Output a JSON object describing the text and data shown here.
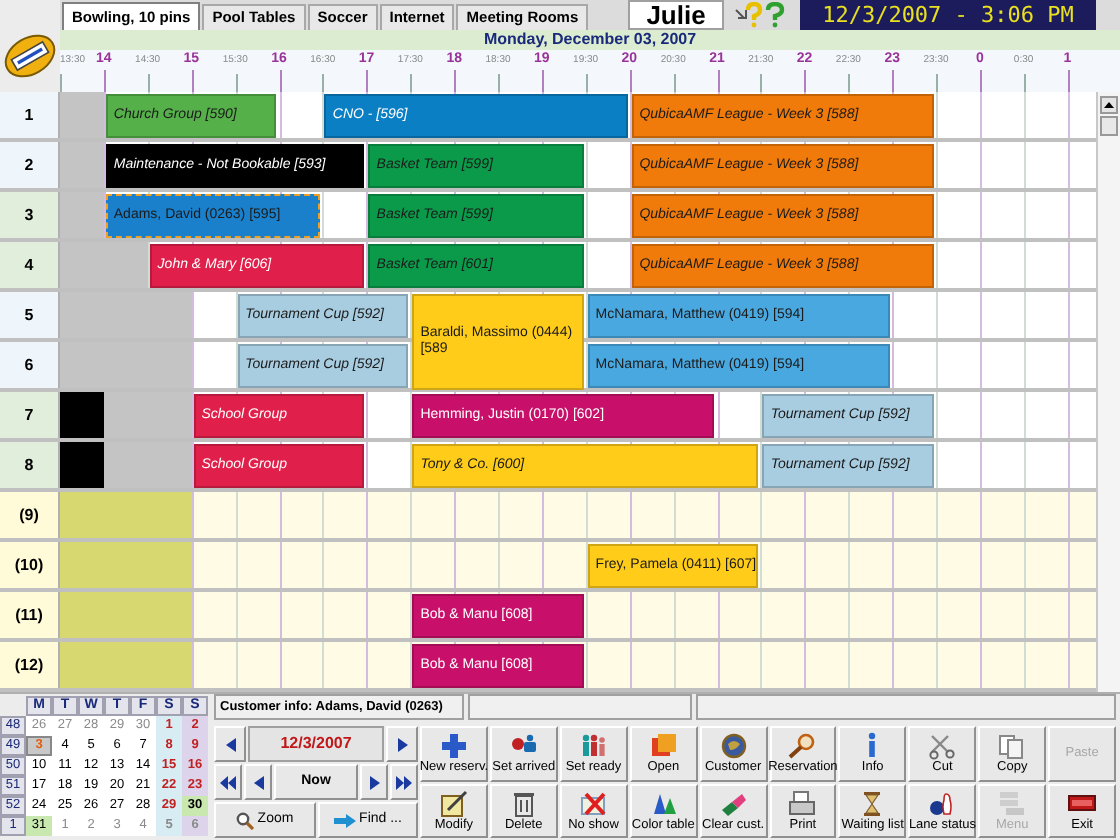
{
  "tabs": [
    {
      "label": "Bowling, 10 pins",
      "selected": true
    },
    {
      "label": "Pool Tables",
      "selected": false
    },
    {
      "label": "Soccer",
      "selected": false
    },
    {
      "label": "Internet",
      "selected": false
    },
    {
      "label": "Meeting Rooms",
      "selected": false
    }
  ],
  "user": "Julie",
  "clock": "12/3/2007 - 3:06 PM",
  "date_heading": "Monday, December 03, 2007",
  "time_scale": [
    {
      "label": "13:30",
      "kind": "minor"
    },
    {
      "label": "14",
      "kind": "major"
    },
    {
      "label": "14:30",
      "kind": "minor"
    },
    {
      "label": "15",
      "kind": "major"
    },
    {
      "label": "15:30",
      "kind": "minor"
    },
    {
      "label": "16",
      "kind": "major"
    },
    {
      "label": "16:30",
      "kind": "minor"
    },
    {
      "label": "17",
      "kind": "major"
    },
    {
      "label": "17:30",
      "kind": "minor"
    },
    {
      "label": "18",
      "kind": "major"
    },
    {
      "label": "18:30",
      "kind": "minor"
    },
    {
      "label": "19",
      "kind": "major"
    },
    {
      "label": "19:30",
      "kind": "minor"
    },
    {
      "label": "20",
      "kind": "major"
    },
    {
      "label": "20:30",
      "kind": "minor"
    },
    {
      "label": "21",
      "kind": "major"
    },
    {
      "label": "21:30",
      "kind": "minor"
    },
    {
      "label": "22",
      "kind": "major"
    },
    {
      "label": "22:30",
      "kind": "minor"
    },
    {
      "label": "23",
      "kind": "major"
    },
    {
      "label": "23:30",
      "kind": "minor"
    },
    {
      "label": "0",
      "kind": "major"
    },
    {
      "label": "0:30",
      "kind": "minor"
    },
    {
      "label": "1",
      "kind": "major"
    }
  ],
  "lanes": [
    {
      "label": "1",
      "active": true,
      "cells": [
        {
          "kind": "unavailable"
        },
        {
          "kind": "group",
          "label": "Church Group [590]",
          "color": "#56b04a",
          "selected": false,
          "spans_next_lane": false
        },
        {
          "kind": "cont"
        },
        {
          "kind": "cont"
        },
        {
          "kind": "cont"
        },
        {
          "kind": "free"
        },
        {
          "kind": "group",
          "label": "CNO - [596]",
          "color": "#0a7fc4",
          "selected": false,
          "spans_next_lane": false
        },
        {
          "kind": "cont"
        },
        {
          "kind": "cont"
        },
        {
          "kind": "cont"
        },
        {
          "kind": "cont"
        },
        {
          "kind": "cont"
        },
        {
          "kind": "cont"
        },
        {
          "kind": "group",
          "label": "QubicaAMF League - Week 3 [588]",
          "color": "#f07a0a",
          "selected": false,
          "spans_next_lane": false
        },
        {
          "kind": "cont"
        },
        {
          "kind": "cont"
        },
        {
          "kind": "cont"
        },
        {
          "kind": "cont"
        },
        {
          "kind": "cont"
        },
        {
          "kind": "cont"
        }
      ]
    },
    {
      "label": "2",
      "active": true,
      "cells": [
        {
          "kind": "unavailable"
        },
        {
          "kind": "group",
          "label": "Maintenance - Not Bookable [593]",
          "color": "#000000",
          "selected": false,
          "spans_next_lane": false
        },
        {
          "kind": "cont"
        },
        {
          "kind": "cont"
        },
        {
          "kind": "cont"
        },
        {
          "kind": "cont"
        },
        {
          "kind": "cont"
        },
        {
          "kind": "group",
          "label": "Basket Team [599]",
          "color": "#0a9a4a",
          "selected": false,
          "spans_next_lane": false
        },
        {
          "kind": "cont"
        },
        {
          "kind": "cont"
        },
        {
          "kind": "cont"
        },
        {
          "kind": "cont"
        },
        {
          "kind": "free"
        },
        {
          "kind": "group",
          "label": "QubicaAMF League - Week 3 [588]",
          "color": "#f07a0a",
          "selected": false,
          "spans_next_lane": false
        },
        {
          "kind": "cont"
        },
        {
          "kind": "cont"
        },
        {
          "kind": "cont"
        },
        {
          "kind": "cont"
        },
        {
          "kind": "cont"
        },
        {
          "kind": "cont"
        }
      ]
    },
    {
      "label": "3",
      "active": true,
      "cells": [
        {
          "kind": "unavailable"
        },
        {
          "kind": "customer",
          "label": "Adams, David (0263) [595]",
          "color": "#1a80cc",
          "selected": true,
          "spans_next_lane": false
        },
        {
          "kind": "cont"
        },
        {
          "kind": "cont"
        },
        {
          "kind": "cont"
        },
        {
          "kind": "cont"
        },
        {
          "kind": "free"
        },
        {
          "kind": "group",
          "label": "Basket Team [599]",
          "color": "#0a9a4a",
          "selected": false,
          "spans_next_lane": false
        },
        {
          "kind": "cont"
        },
        {
          "kind": "cont"
        },
        {
          "kind": "cont"
        },
        {
          "kind": "cont"
        },
        {
          "kind": "free"
        },
        {
          "kind": "group",
          "label": "QubicaAMF League - Week 3 [588]",
          "color": "#f07a0a",
          "selected": false,
          "spans_next_lane": false
        },
        {
          "kind": "cont"
        },
        {
          "kind": "cont"
        },
        {
          "kind": "cont"
        },
        {
          "kind": "cont"
        },
        {
          "kind": "cont"
        },
        {
          "kind": "cont"
        }
      ]
    },
    {
      "label": "4",
      "active": true,
      "cells": [
        {
          "kind": "unavailable"
        },
        {
          "kind": "unavailable"
        },
        {
          "kind": "group",
          "label": "John & Mary [606]",
          "color": "#e0204a",
          "selected": false,
          "spans_next_lane": false
        },
        {
          "kind": "cont"
        },
        {
          "kind": "cont"
        },
        {
          "kind": "cont"
        },
        {
          "kind": "cont"
        },
        {
          "kind": "group",
          "label": "Basket Team [601]",
          "color": "#0a9a4a",
          "selected": false,
          "spans_next_lane": false
        },
        {
          "kind": "cont"
        },
        {
          "kind": "cont"
        },
        {
          "kind": "cont"
        },
        {
          "kind": "cont"
        },
        {
          "kind": "free"
        },
        {
          "kind": "group",
          "label": "QubicaAMF League - Week 3 [588]",
          "color": "#f07a0a",
          "selected": false,
          "spans_next_lane": false
        },
        {
          "kind": "cont"
        },
        {
          "kind": "cont"
        },
        {
          "kind": "cont"
        },
        {
          "kind": "cont"
        },
        {
          "kind": "cont"
        },
        {
          "kind": "cont"
        }
      ]
    },
    {
      "label": "5",
      "active": true,
      "cells": [
        {
          "kind": "unavailable"
        },
        {
          "kind": "unavailable"
        },
        {
          "kind": "unavailable"
        },
        {
          "kind": "free"
        },
        {
          "kind": "group",
          "label": "Tournament Cup [592]",
          "color": "#a8cce0",
          "selected": false,
          "spans_next_lane": false
        },
        {
          "kind": "cont"
        },
        {
          "kind": "cont"
        },
        {
          "kind": "cont"
        },
        {
          "kind": "customer",
          "label": "Baraldi, Massimo (0444) [589",
          "color": "#ffcc1a",
          "selected": false,
          "spans_next_lane": true
        },
        {
          "kind": "cont"
        },
        {
          "kind": "cont"
        },
        {
          "kind": "cont"
        },
        {
          "kind": "customer",
          "label": "McNamara, Matthew (0419) [594]",
          "color": "#4aa8e0",
          "selected": false,
          "spans_next_lane": false
        },
        {
          "kind": "cont"
        },
        {
          "kind": "cont"
        },
        {
          "kind": "cont"
        },
        {
          "kind": "cont"
        },
        {
          "kind": "cont"
        },
        {
          "kind": "cont"
        }
      ]
    },
    {
      "label": "6",
      "active": true,
      "cells": [
        {
          "kind": "unavailable"
        },
        {
          "kind": "unavailable"
        },
        {
          "kind": "unavailable"
        },
        {
          "kind": "free"
        },
        {
          "kind": "group",
          "label": "Tournament Cup [592]",
          "color": "#a8cce0",
          "selected": false,
          "spans_next_lane": false
        },
        {
          "kind": "cont"
        },
        {
          "kind": "cont"
        },
        {
          "kind": "cont"
        },
        {
          "kind": "covered"
        },
        {
          "kind": "covered"
        },
        {
          "kind": "covered"
        },
        {
          "kind": "covered"
        },
        {
          "kind": "customer",
          "label": "McNamara, Matthew (0419) [594]",
          "color": "#4aa8e0",
          "selected": false,
          "spans_next_lane": false
        },
        {
          "kind": "cont"
        },
        {
          "kind": "cont"
        },
        {
          "kind": "cont"
        },
        {
          "kind": "cont"
        },
        {
          "kind": "cont"
        },
        {
          "kind": "cont"
        }
      ]
    },
    {
      "label": "7",
      "active": true,
      "cells": [
        {
          "kind": "closed"
        },
        {
          "kind": "unavailable"
        },
        {
          "kind": "unavailable"
        },
        {
          "kind": "group",
          "label": "School Group",
          "color": "#e0204a",
          "selected": false,
          "spans_next_lane": false
        },
        {
          "kind": "cont"
        },
        {
          "kind": "cont"
        },
        {
          "kind": "cont"
        },
        {
          "kind": "free"
        },
        {
          "kind": "customer",
          "label": "Hemming, Justin (0170) [602]",
          "color": "#c8106a",
          "selected": false,
          "spans_next_lane": false
        },
        {
          "kind": "cont"
        },
        {
          "kind": "cont"
        },
        {
          "kind": "cont"
        },
        {
          "kind": "cont"
        },
        {
          "kind": "cont"
        },
        {
          "kind": "cont"
        },
        {
          "kind": "free"
        },
        {
          "kind": "group",
          "label": "Tournament Cup [592]",
          "color": "#a8cce0",
          "selected": false,
          "spans_next_lane": false
        },
        {
          "kind": "cont"
        },
        {
          "kind": "cont"
        },
        {
          "kind": "cont"
        }
      ]
    },
    {
      "label": "8",
      "active": true,
      "cells": [
        {
          "kind": "closed"
        },
        {
          "kind": "unavailable"
        },
        {
          "kind": "unavailable"
        },
        {
          "kind": "group",
          "label": "School Group",
          "color": "#e0204a",
          "selected": false,
          "spans_next_lane": false
        },
        {
          "kind": "cont"
        },
        {
          "kind": "cont"
        },
        {
          "kind": "cont"
        },
        {
          "kind": "free"
        },
        {
          "kind": "group",
          "label": "Tony & Co. [600]",
          "color": "#ffcc1a",
          "selected": false,
          "spans_next_lane": false
        },
        {
          "kind": "cont"
        },
        {
          "kind": "cont"
        },
        {
          "kind": "cont"
        },
        {
          "kind": "cont"
        },
        {
          "kind": "cont"
        },
        {
          "kind": "cont"
        },
        {
          "kind": "cont"
        },
        {
          "kind": "group",
          "label": "Tournament Cup [592]",
          "color": "#a8cce0",
          "selected": false,
          "spans_next_lane": false
        },
        {
          "kind": "cont"
        },
        {
          "kind": "cont"
        },
        {
          "kind": "cont"
        }
      ]
    },
    {
      "label": "(9)",
      "active": false,
      "cells": [
        {
          "kind": "unavailable"
        },
        {
          "kind": "unavailable"
        },
        {
          "kind": "unavailable"
        }
      ]
    },
    {
      "label": "(10)",
      "active": false,
      "cells": [
        {
          "kind": "unavailable"
        },
        {
          "kind": "unavailable"
        },
        {
          "kind": "unavailable"
        },
        {
          "kind": "free"
        },
        {
          "kind": "free"
        },
        {
          "kind": "free"
        },
        {
          "kind": "free"
        },
        {
          "kind": "free"
        },
        {
          "kind": "free"
        },
        {
          "kind": "free"
        },
        {
          "kind": "free"
        },
        {
          "kind": "free"
        },
        {
          "kind": "customer",
          "label": "Frey, Pamela (0411) [607]",
          "color": "#ffcc1a",
          "selected": false,
          "spans_next_lane": false
        },
        {
          "kind": "cont"
        },
        {
          "kind": "cont"
        },
        {
          "kind": "cont"
        }
      ]
    },
    {
      "label": "(11)",
      "active": false,
      "cells": [
        {
          "kind": "unavailable"
        },
        {
          "kind": "unavailable"
        },
        {
          "kind": "unavailable"
        },
        {
          "kind": "free"
        },
        {
          "kind": "free"
        },
        {
          "kind": "free"
        },
        {
          "kind": "free"
        },
        {
          "kind": "free"
        },
        {
          "kind": "customer",
          "label": "Bob & Manu [608]",
          "color": "#c8106a",
          "selected": false,
          "spans_next_lane": false
        },
        {
          "kind": "cont"
        },
        {
          "kind": "cont"
        },
        {
          "kind": "cont"
        }
      ]
    },
    {
      "label": "(12)",
      "active": false,
      "cells": [
        {
          "kind": "unavailable"
        },
        {
          "kind": "unavailable"
        },
        {
          "kind": "unavailable"
        },
        {
          "kind": "free"
        },
        {
          "kind": "free"
        },
        {
          "kind": "free"
        },
        {
          "kind": "free"
        },
        {
          "kind": "free"
        },
        {
          "kind": "customer",
          "label": "Bob & Manu [608]",
          "color": "#c8106a",
          "selected": false,
          "spans_next_lane": false
        },
        {
          "kind": "cont"
        },
        {
          "kind": "cont"
        },
        {
          "kind": "cont"
        }
      ]
    }
  ],
  "calendar": {
    "headers": [
      "M",
      "T",
      "W",
      "T",
      "F",
      "S",
      "S"
    ],
    "weeks": [
      {
        "number": "48",
        "days": [
          {
            "label": "26",
            "muted": true,
            "selected": false,
            "highlighted": false
          },
          {
            "label": "27",
            "muted": true,
            "selected": false,
            "highlighted": false
          },
          {
            "label": "28",
            "muted": true,
            "selected": false,
            "highlighted": false
          },
          {
            "label": "29",
            "muted": true,
            "selected": false,
            "highlighted": false
          },
          {
            "label": "30",
            "muted": true,
            "selected": false,
            "highlighted": false
          },
          {
            "label": "1",
            "muted": false,
            "selected": false,
            "highlighted": false
          },
          {
            "label": "2",
            "muted": false,
            "selected": false,
            "highlighted": false
          }
        ]
      },
      {
        "number": "49",
        "days": [
          {
            "label": "3",
            "muted": false,
            "selected": true,
            "highlighted": false
          },
          {
            "label": "4",
            "muted": false,
            "selected": false,
            "highlighted": false
          },
          {
            "label": "5",
            "muted": false,
            "selected": false,
            "highlighted": false
          },
          {
            "label": "6",
            "muted": false,
            "selected": false,
            "highlighted": false
          },
          {
            "label": "7",
            "muted": false,
            "selected": false,
            "highlighted": false
          },
          {
            "label": "8",
            "muted": false,
            "selected": false,
            "highlighted": false
          },
          {
            "label": "9",
            "muted": false,
            "selected": false,
            "highlighted": false
          }
        ]
      },
      {
        "number": "50",
        "days": [
          {
            "label": "10",
            "muted": false,
            "selected": false,
            "highlighted": false
          },
          {
            "label": "11",
            "muted": false,
            "selected": false,
            "highlighted": false
          },
          {
            "label": "12",
            "muted": false,
            "selected": false,
            "highlighted": false
          },
          {
            "label": "13",
            "muted": false,
            "selected": false,
            "highlighted": false
          },
          {
            "label": "14",
            "muted": false,
            "selected": false,
            "highlighted": false
          },
          {
            "label": "15",
            "muted": false,
            "selected": false,
            "highlighted": false
          },
          {
            "label": "16",
            "muted": false,
            "selected": false,
            "highlighted": false
          }
        ]
      },
      {
        "number": "51",
        "days": [
          {
            "label": "17",
            "muted": false,
            "selected": false,
            "highlighted": false
          },
          {
            "label": "18",
            "muted": false,
            "selected": false,
            "highlighted": false
          },
          {
            "label": "19",
            "muted": false,
            "selected": false,
            "highlighted": false
          },
          {
            "label": "20",
            "muted": false,
            "selected": false,
            "highlighted": false
          },
          {
            "label": "21",
            "muted": false,
            "selected": false,
            "highlighted": false
          },
          {
            "label": "22",
            "muted": false,
            "selected": false,
            "highlighted": false
          },
          {
            "label": "23",
            "muted": false,
            "selected": false,
            "highlighted": false
          }
        ]
      },
      {
        "number": "52",
        "days": [
          {
            "label": "24",
            "muted": false,
            "selected": false,
            "highlighted": false
          },
          {
            "label": "25",
            "muted": false,
            "selected": false,
            "highlighted": false
          },
          {
            "label": "26",
            "muted": false,
            "selected": false,
            "highlighted": false
          },
          {
            "label": "27",
            "muted": false,
            "selected": false,
            "highlighted": false
          },
          {
            "label": "28",
            "muted": false,
            "selected": false,
            "highlighted": false
          },
          {
            "label": "29",
            "muted": false,
            "selected": false,
            "highlighted": false
          },
          {
            "label": "30",
            "muted": false,
            "selected": false,
            "highlighted": true
          }
        ]
      },
      {
        "number": "1",
        "days": [
          {
            "label": "31",
            "muted": false,
            "selected": false,
            "highlighted": true
          },
          {
            "label": "1",
            "muted": true,
            "selected": false,
            "highlighted": false
          },
          {
            "label": "2",
            "muted": true,
            "selected": false,
            "highlighted": false
          },
          {
            "label": "3",
            "muted": true,
            "selected": false,
            "highlighted": false
          },
          {
            "label": "4",
            "muted": true,
            "selected": false,
            "highlighted": false
          },
          {
            "label": "5",
            "muted": true,
            "selected": false,
            "highlighted": false
          },
          {
            "label": "6",
            "muted": true,
            "selected": false,
            "highlighted": false
          }
        ]
      }
    ]
  },
  "customer_info": "Customer info: Adams, David (0263)",
  "navigator": {
    "date": "12/3/2007",
    "now_button": "Now",
    "zoom_button": "Zoom",
    "find_button": "Find ..."
  },
  "buttons": [
    {
      "label": "New reserv.",
      "disabled": false
    },
    {
      "label": "Set arrived",
      "disabled": false
    },
    {
      "label": "Set ready",
      "disabled": false
    },
    {
      "label": "Open",
      "disabled": false
    },
    {
      "label": "Customer",
      "disabled": false
    },
    {
      "label": "Reservation",
      "disabled": false
    },
    {
      "label": "Info",
      "disabled": false
    },
    {
      "label": "Cut",
      "disabled": false
    },
    {
      "label": "Copy",
      "disabled": false
    },
    {
      "label": "Paste",
      "disabled": true
    },
    {
      "label": "Modify",
      "disabled": false
    },
    {
      "label": "Delete",
      "disabled": false
    },
    {
      "label": "No show",
      "disabled": false
    },
    {
      "label": "Color table",
      "disabled": false
    },
    {
      "label": "Clear cust.",
      "disabled": false
    },
    {
      "label": "Print",
      "disabled": false
    },
    {
      "label": "Waiting list",
      "disabled": false
    },
    {
      "label": "Lane status",
      "disabled": false
    },
    {
      "label": "Menu",
      "disabled": true
    },
    {
      "label": "Exit",
      "disabled": false
    }
  ]
}
